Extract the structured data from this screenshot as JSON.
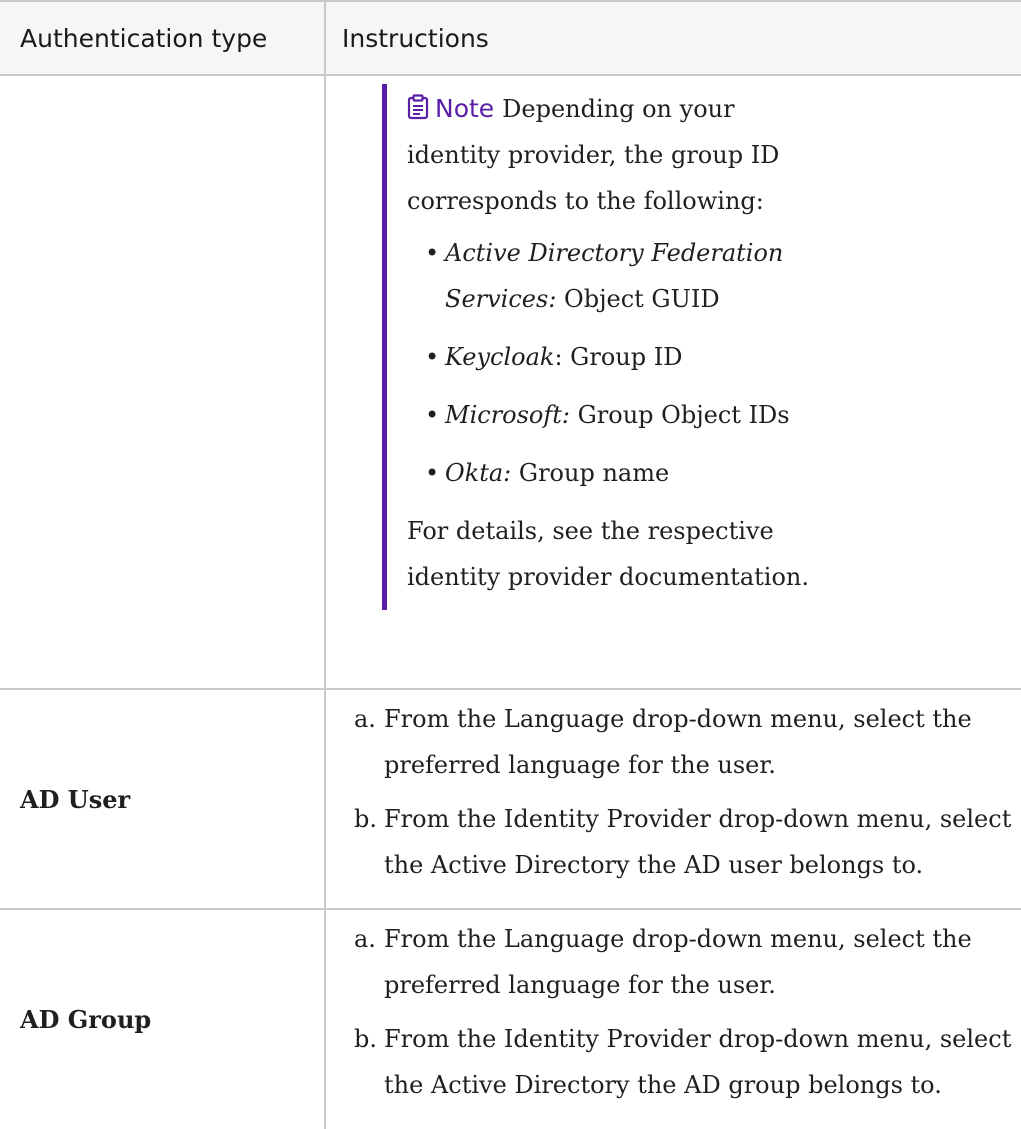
{
  "table": {
    "headers": {
      "type": "Authentication type",
      "instructions": "Instructions"
    },
    "note": {
      "label": "Note",
      "intro": "Depending on your identity provider, the group ID corresponds to the following:",
      "items": [
        {
          "provider": "Active Directory Federation Services:",
          "value": " Object GUID"
        },
        {
          "provider": "Keycloak",
          "value": ": Group ID"
        },
        {
          "provider": "Microsoft:",
          "value": " Group Object IDs"
        },
        {
          "provider": "Okta:",
          "value": " Group name"
        }
      ],
      "footer": "For details, see the respective identity provider documentation.",
      "icon": "clipboard-icon",
      "accent_color": "#5a1fa7"
    },
    "rows": [
      {
        "type": "AD User",
        "steps": [
          {
            "marker": "a.",
            "text": "From the Language drop-down menu, select the preferred language for the user."
          },
          {
            "marker": "b.",
            "text": "From the Identity Provider drop-down menu, select the Active Directory the AD user belongs to."
          }
        ]
      },
      {
        "type": "AD Group",
        "steps": [
          {
            "marker": "a.",
            "text": "From the Language drop-down menu, select the preferred language for the user."
          },
          {
            "marker": "b.",
            "text": "From the Identity Provider drop-down menu, select the Active Directory the AD group belongs to."
          }
        ]
      }
    ]
  }
}
